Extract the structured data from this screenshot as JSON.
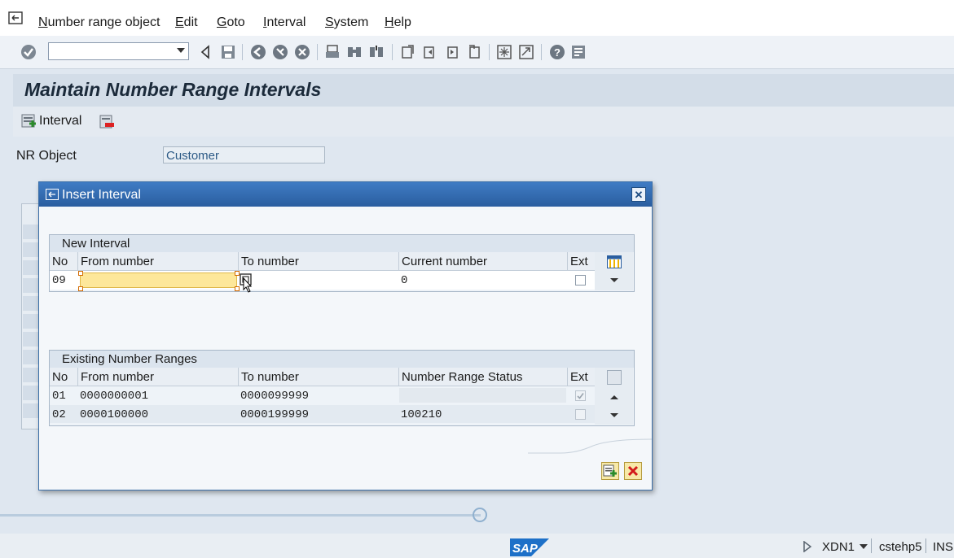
{
  "menubar": {
    "items": [
      {
        "label": "Number range object",
        "key": "N"
      },
      {
        "label": "Edit",
        "key": "E"
      },
      {
        "label": "Goto",
        "key": "G"
      },
      {
        "label": "Interval",
        "key": "I"
      },
      {
        "label": "System",
        "key": "S"
      },
      {
        "label": "Help",
        "key": "H"
      }
    ]
  },
  "toolbar": {
    "command_field_value": ""
  },
  "page": {
    "title": "Maintain Number Range Intervals",
    "interval_button_label": "Interval",
    "nr_object_label": "NR Object",
    "nr_object_value": "Customer"
  },
  "dialog": {
    "title": "Insert Interval",
    "new_interval": {
      "group_title": "New Interval",
      "columns": [
        "No",
        "From number",
        "To number",
        "Current number",
        "Ext"
      ],
      "row": {
        "no": "09",
        "from": "",
        "to": "",
        "current": "0",
        "ext": false
      }
    },
    "existing": {
      "group_title": "Existing Number Ranges",
      "columns": [
        "No",
        "From number",
        "To number",
        "Number Range Status",
        "Ext"
      ],
      "rows": [
        {
          "no": "01",
          "from": "0000000001",
          "to": "0000099999",
          "status": "",
          "ext": true
        },
        {
          "no": "02",
          "from": "0000100000",
          "to": "0000199999",
          "status": "100210",
          "ext": false
        }
      ]
    }
  },
  "status": {
    "system": "XDN1",
    "server": "cstehp5",
    "mode": "INS",
    "logo_text": "SAP"
  },
  "colors": {
    "dialog_title_bg": "#2a5e9f",
    "input_highlight": "#fde79a",
    "page_bg": "#dfe7f0"
  }
}
